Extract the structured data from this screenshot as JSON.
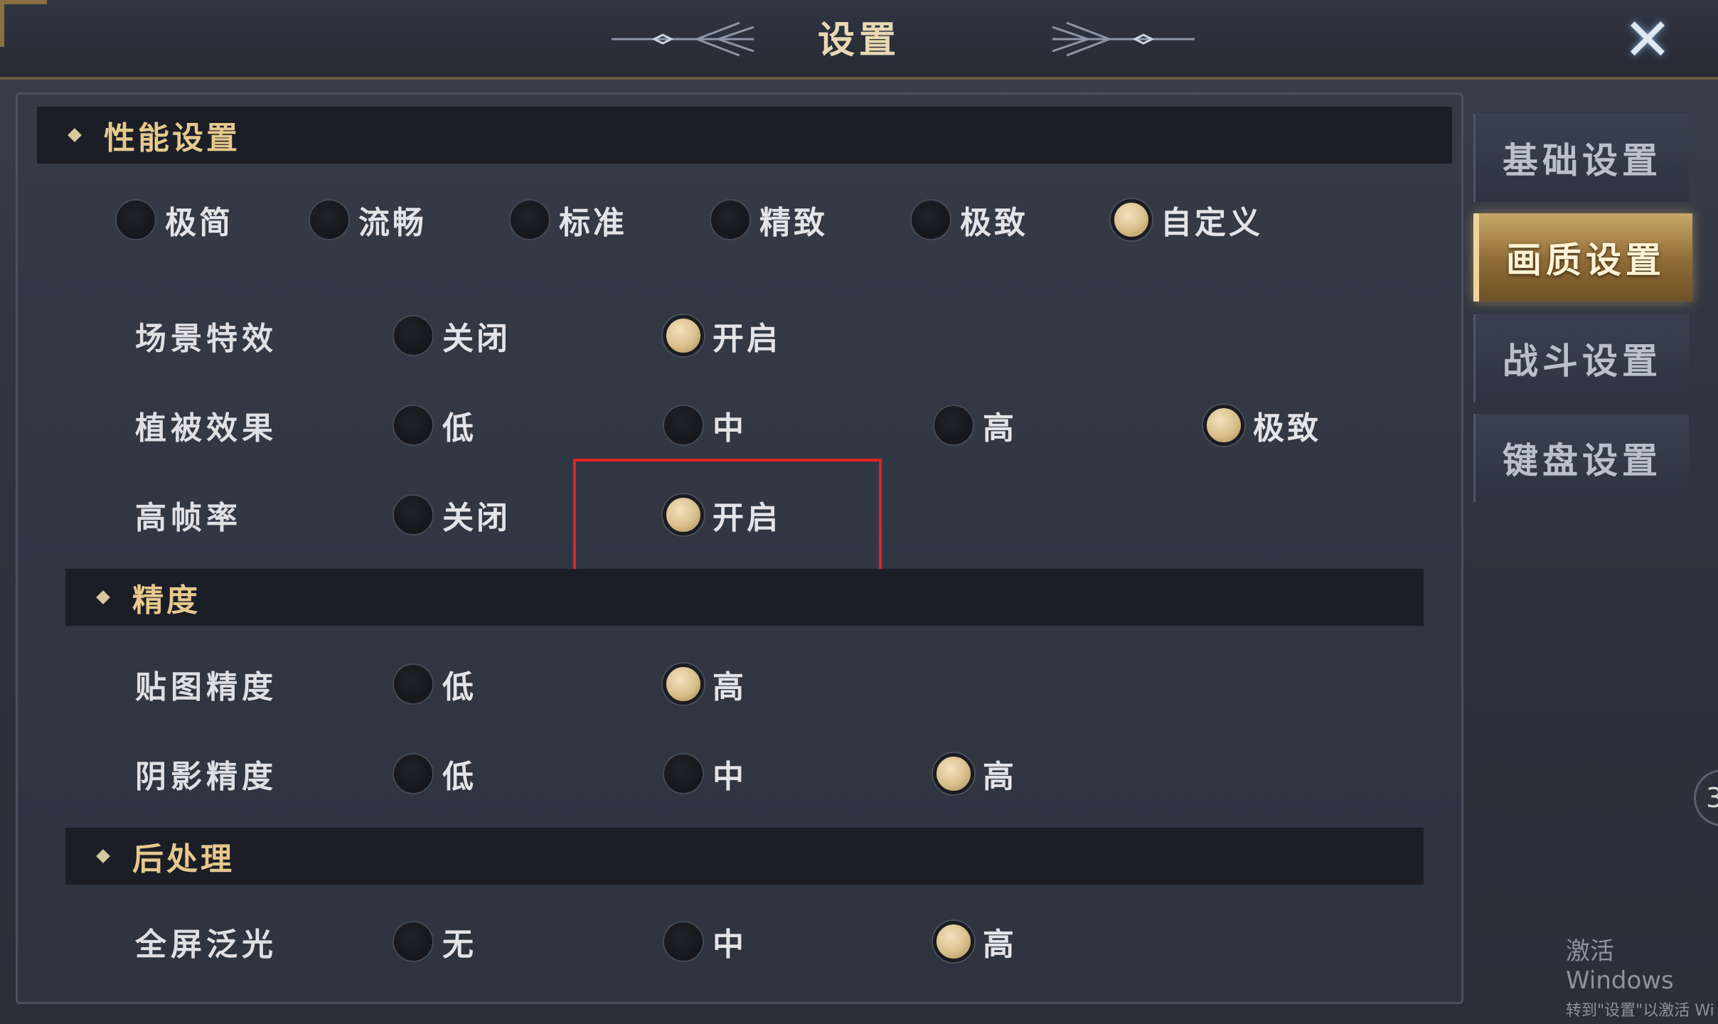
{
  "window": {
    "title": "设置",
    "close_icon": "close-x-icon"
  },
  "tabs": [
    {
      "label": "基础设置",
      "active": false
    },
    {
      "label": "画质设置",
      "active": true
    },
    {
      "label": "战斗设置",
      "active": false
    },
    {
      "label": "键盘设置",
      "active": false
    }
  ],
  "sections": {
    "performance": "性能设置",
    "precision": "精度",
    "postprocess": "后处理"
  },
  "presets": [
    {
      "label": "极简",
      "selected": false
    },
    {
      "label": "流畅",
      "selected": false
    },
    {
      "label": "标准",
      "selected": false
    },
    {
      "label": "精致",
      "selected": false
    },
    {
      "label": "极致",
      "selected": false
    },
    {
      "label": "自定义",
      "selected": true
    }
  ],
  "rows": {
    "scene_effects": {
      "label": "场景特效",
      "options": [
        "关闭",
        "开启"
      ],
      "selected": 1
    },
    "vegetation": {
      "label": "植被效果",
      "options": [
        "低",
        "中",
        "高",
        "极致"
      ],
      "selected": 3
    },
    "high_fps": {
      "label": "高帧率",
      "options": [
        "关闭",
        "开启"
      ],
      "selected": 1
    },
    "texture": {
      "label": "贴图精度",
      "options": [
        "低",
        "高"
      ],
      "selected": 1
    },
    "shadow": {
      "label": "阴影精度",
      "options": [
        "低",
        "中",
        "高"
      ],
      "selected": 2
    },
    "bloom": {
      "label": "全屏泛光",
      "options": [
        "无",
        "中",
        "高"
      ],
      "selected": 2
    }
  },
  "side_badge": "3",
  "watermark": {
    "line1": "激活 Windows",
    "line2": "转到\"设置\"以激活 Wi"
  },
  "colors": {
    "accent_gold": "#e6c98d",
    "highlight_red": "#e02420"
  }
}
